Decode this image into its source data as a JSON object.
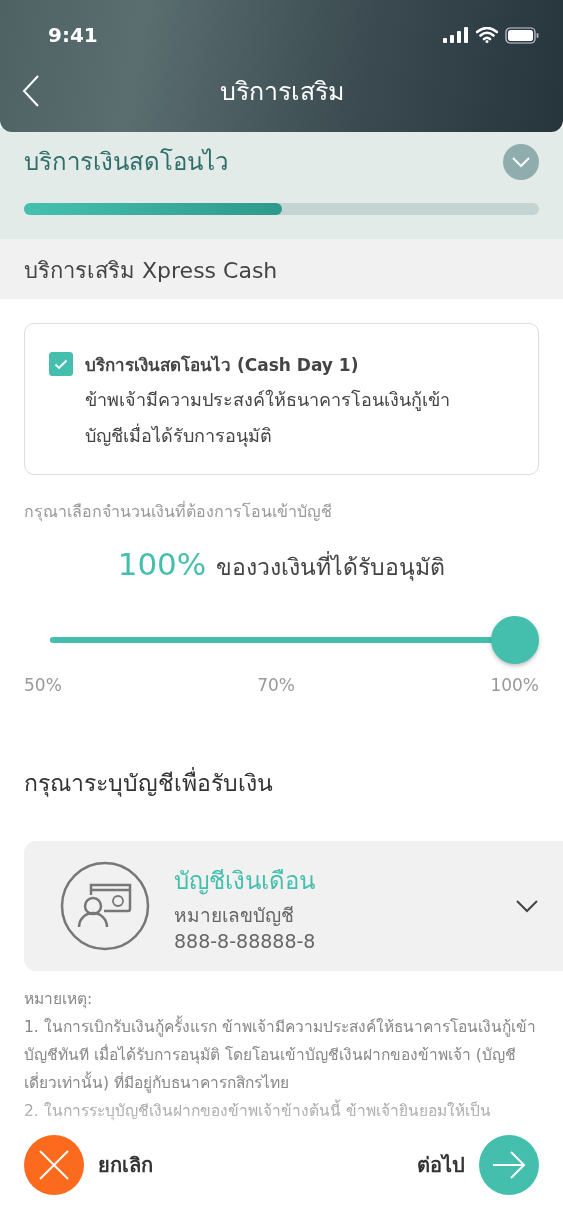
{
  "status_bar": {
    "time": "9:41"
  },
  "header": {
    "title": "บริการเสริม"
  },
  "step": {
    "title": "บริการเงินสดโอนไว",
    "level": 0.5
  },
  "section": {
    "title": "บริการเสริม Xpress Cash"
  },
  "option": {
    "checked": true,
    "title": "บริการเงินสดโอนไว (Cash Day 1)",
    "description": "ข้าพเจ้ามีความประสงค์ให้ธนาคารโอนเงินกู้เข้าบัญชีเมื่อได้รับการอนุมัติ"
  },
  "amount": {
    "label": "กรุณาเลือกจำนวนเงินที่ต้องการโอนเข้าบัญชี",
    "percent": "100%",
    "suffix": "ของวงเงินที่ได้รับอนุมัติ",
    "level": 1,
    "ticks": [
      "50%",
      "70%",
      "100%"
    ]
  },
  "account_heading": "กรุณาระบุบัญชีเพื่อรับเงิน",
  "account": {
    "name": "บัญชีเงินเดือน",
    "number_label": "หมายเลขบัญชี",
    "number": "888-8-88888-8"
  },
  "notes": {
    "title": "หมายเหตุ:",
    "items": [
      "1. ในการเบิกรับเงินกู้ครั้งแรก ข้าพเจ้ามีความประสงค์ให้ธนาคารโอนเงินกู้เข้าบัญชีทันที เมื่อได้รับการอนุมัติ โดยโอนเข้าบัญชีเงินฝากของข้าพเจ้า (บัญชีเดี่ยวเท่านั้น) ที่มีอยู่กับธนาคารกสิกรไทย",
      "2. ในการระบุบัญชีเงินฝากของข้าพเจ้าข้างต้นนี้ ข้าพเจ้ายินยอมให้เป็น"
    ]
  },
  "footer": {
    "cancel": "ยกเลิก",
    "next": "ต่อไป"
  }
}
